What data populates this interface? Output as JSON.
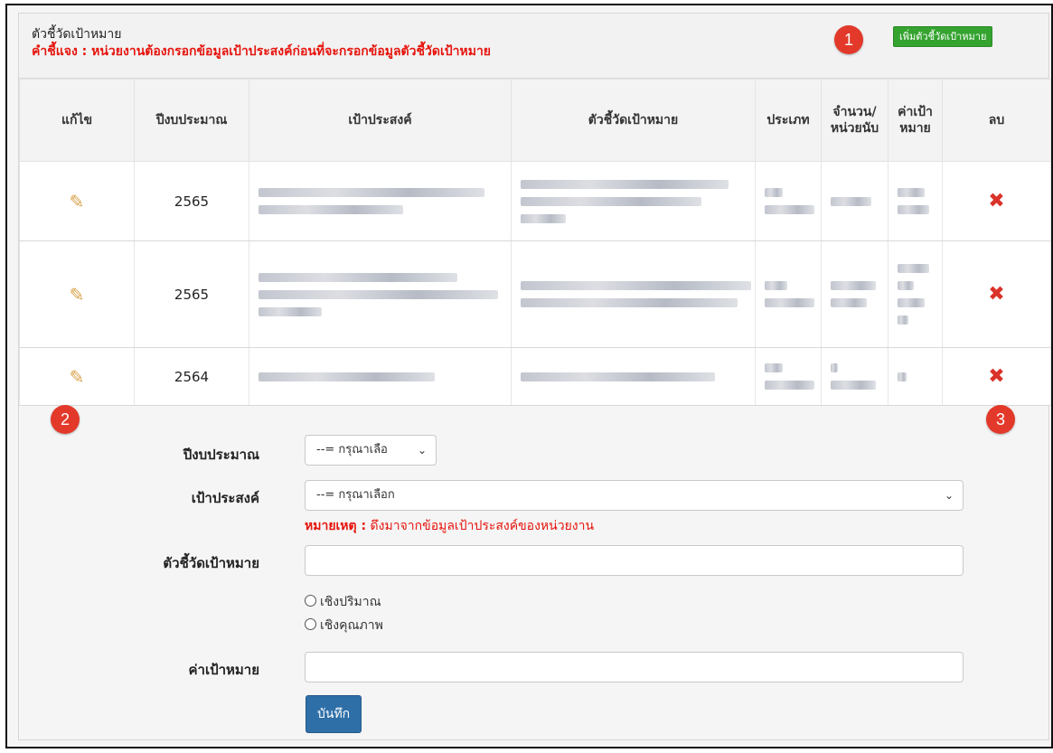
{
  "header": {
    "title": "ตัวชี้วัดเป้าหมาย",
    "note": "คำชี้แจง : หน่วยงานต้องกรอกข้อมูลเป้าประสงค์ก่อนที่จะกรอกข้อมูลตัวชี้วัดเป้าหมาย",
    "add_button": "เพิ่มตัวชี้วัดเป้าหมาย"
  },
  "badges": {
    "b1": "1",
    "b2": "2",
    "b3": "3"
  },
  "table": {
    "headers": {
      "edit": "แก้ไข",
      "year": "ปีงบประมาณ",
      "objective": "เป้าประสงค์",
      "indicator": "ตัวชี้วัดเป้าหมาย",
      "type": "ประเภท",
      "unit": "จำนวน/หน่วยนับ",
      "target": "ค่าเป้าหมาย",
      "delete": "ลบ"
    },
    "rows": [
      {
        "year": "2565"
      },
      {
        "year": "2565"
      },
      {
        "year": "2564"
      }
    ]
  },
  "icons": {
    "edit": "pencil-icon",
    "delete": "delete-x-icon"
  },
  "form": {
    "year_label": "ปีงบประมาณ",
    "year_value": "--= กรุณาเลือ",
    "objective_label": "เป้าประสงค์",
    "objective_value": "--= กรุณาเลือก",
    "remark_prefix": "หมายเหตุ :",
    "remark_text": " ดึงมาจากข้อมูลเป้าประสงค์ของหน่วยงาน",
    "indicator_label": "ตัวชี้วัดเป้าหมาย",
    "indicator_value": "",
    "radio_quantity": "เชิงปริมาณ",
    "radio_quality": "เชิงคุณภาพ",
    "target_label": "ค่าเป้าหมาย",
    "target_value": "",
    "save_button": "บันทึก"
  },
  "colors": {
    "accent_red": "#e6140d",
    "add_button_green": "#34a32f",
    "save_button_blue": "#2f6fa8",
    "badge_red": "#e3392a"
  }
}
